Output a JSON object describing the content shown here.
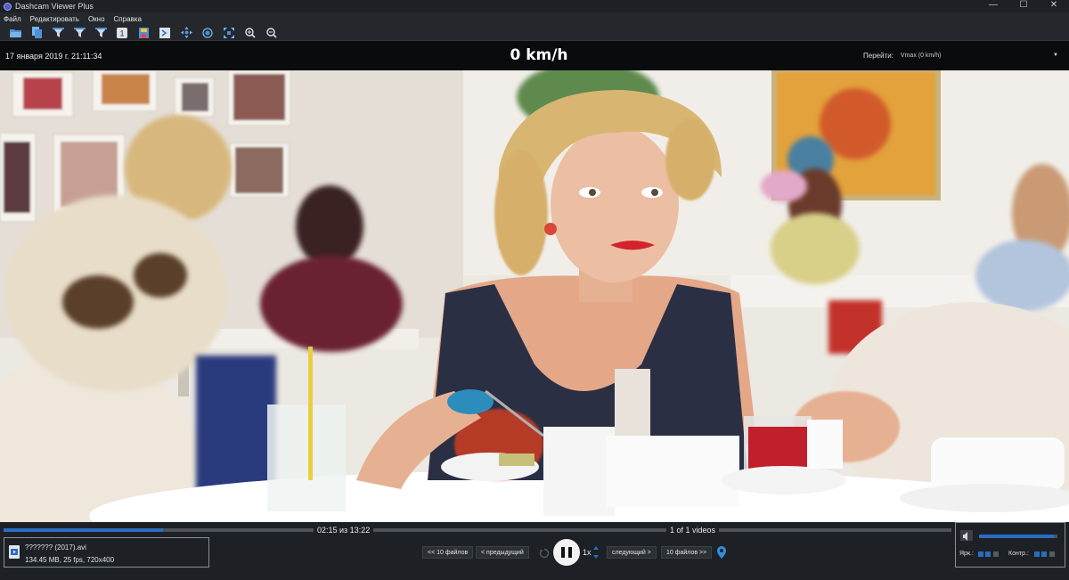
{
  "window": {
    "title": "Dashcam Viewer Plus"
  },
  "menu": [
    "Файл",
    "Редактировать",
    "Окно",
    "Справка"
  ],
  "toolbar": {
    "icons": [
      "open-folder-icon",
      "open-files-icon",
      "filter-icon",
      "filter-add-icon",
      "filter-remove-icon",
      "one-icon",
      "save-icon",
      "export-icon",
      "center-map-icon",
      "locate-icon",
      "fit-icon",
      "zoom-in-icon",
      "zoom-out-icon"
    ]
  },
  "infobar": {
    "datetime": "17 января 2019 г. 21:11:34",
    "speed": "0 km/h",
    "goto_label": "Перейти:",
    "goto_value": "Vmax (0 km/h)"
  },
  "playback": {
    "time": "02:15 из 13:22",
    "video_count": "1 of 1 videos",
    "progress": 0.168,
    "speed_rate": "1x"
  },
  "file": {
    "name": "??????? (2017).avi",
    "meta": "134.45 MB, 25 fps, 720x400"
  },
  "buttons": {
    "back10": "<< 10 файлов",
    "prev": "< предыдущий",
    "next": "следующий >",
    "fwd10": "10 файлов >>"
  },
  "audio": {
    "volume": 0.95,
    "brightness_label": "Ярк.:",
    "contrast_label": "Контр.:"
  },
  "colors": {
    "accent": "#2b6cc4",
    "background": "#1d2125"
  }
}
